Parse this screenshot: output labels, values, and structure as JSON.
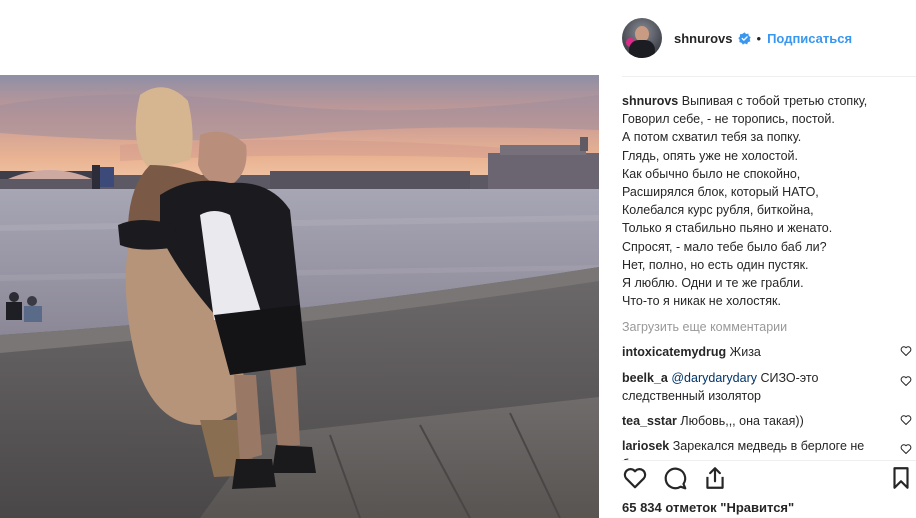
{
  "post": {
    "author": "shnurovs",
    "dot": "•",
    "follow_label": "Подписаться",
    "caption_lines": [
      "Выпивая с тобой третью стопку,",
      "Говорил себе, - не торопись, постой.",
      "А потом схватил тебя за попку.",
      "Глядь, опять уже не холостой.",
      "Как обычно было не спокойно,",
      "Расширялся блок, который НАТО,",
      "Колебался курс рубля, биткойна,",
      "Только я стабильно пьяно и женато.",
      "Спросят, - мало тебе было баб ли?",
      "Нет, полно, но есть один пустяк.",
      "Я люблю. Одни и те же грабли.",
      "Что-то я никак не холостяк."
    ],
    "load_more": "Загрузить еще комментарии",
    "comments": [
      {
        "user": "intoxicatemydrug",
        "text": "Жиза"
      },
      {
        "user": "beelk_a",
        "mention": "@darydarydary",
        "text": "СИЗО-это следственный изолятор"
      },
      {
        "user": "tea_sstar",
        "text": "Любовь,,, она такая))"
      },
      {
        "user": "lariosek",
        "text": "Зарекался медведь в берлоге не бздеть"
      }
    ],
    "likes": "65 834 отметок \"Нравится\""
  },
  "icons": {
    "verified": "verified-badge-icon",
    "heart": "heart-icon",
    "comment": "comment-icon",
    "share": "share-icon",
    "bookmark": "bookmark-icon"
  },
  "colors": {
    "link_blue": "#3897f0",
    "text": "#262626",
    "muted": "#999999",
    "mention": "#003569",
    "separator": "#efefef"
  }
}
